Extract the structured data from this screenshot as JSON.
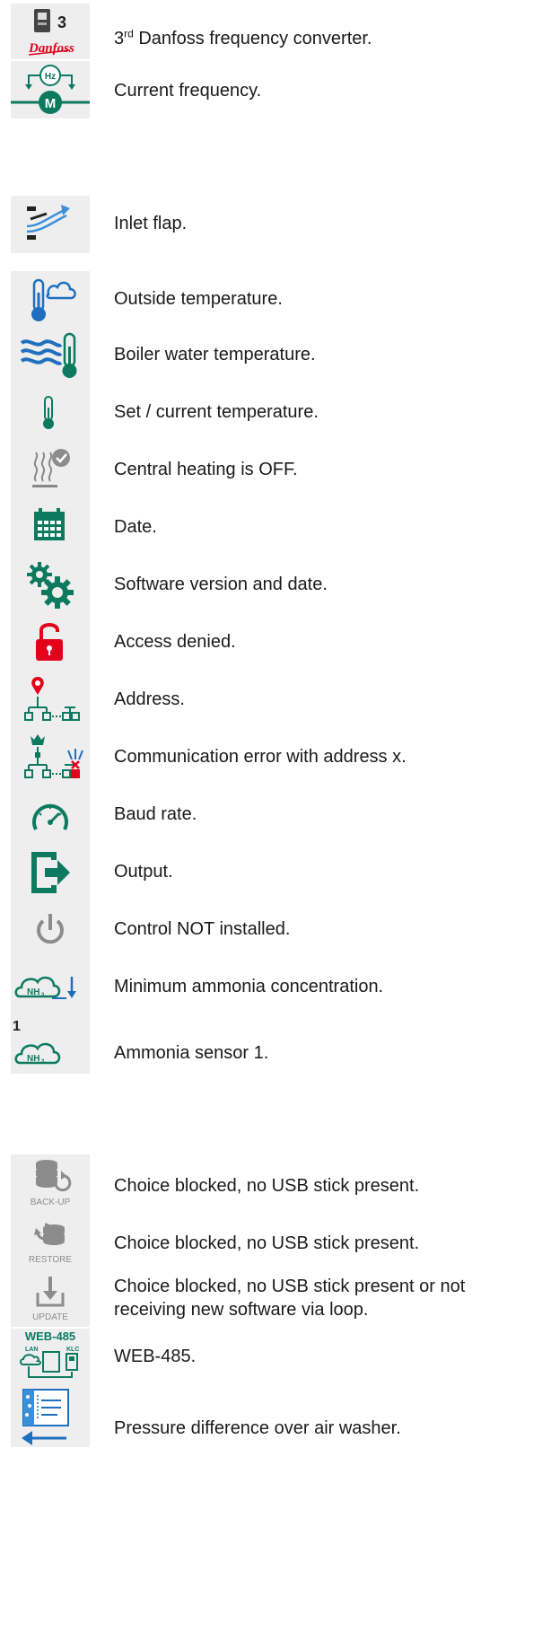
{
  "colors": {
    "green": "#0d7a5f",
    "red": "#e3001b",
    "blue": "#1f6fbf",
    "grey": "#8c8c8c",
    "icon_bg": "#eeeeee"
  },
  "rows": [
    {
      "icon": "danfoss-converter-icon",
      "icon_text_number": "3",
      "icon_text_brand": "Danfoss",
      "label_prefix": "3",
      "label_sup": "rd",
      "label": " Danfoss frequency converter."
    },
    {
      "icon": "frequency-motor-icon",
      "icon_text_hz": "Hz",
      "icon_text_m": "M",
      "label": "Current frequency."
    },
    {
      "icon": "inlet-flap-icon",
      "label": "Inlet flap."
    },
    {
      "icon": "outside-temperature-icon",
      "label": "Outside temperature."
    },
    {
      "icon": "boiler-water-temperature-icon",
      "label": "Boiler water temperature."
    },
    {
      "icon": "thermometer-icon",
      "label": "Set / current temperature."
    },
    {
      "icon": "central-heating-off-icon",
      "label": "Central heating is OFF."
    },
    {
      "icon": "calendar-icon",
      "label": "Date."
    },
    {
      "icon": "gears-icon",
      "label": "Software version and date."
    },
    {
      "icon": "unlocked-padlock-icon",
      "label": "Access denied."
    },
    {
      "icon": "address-network-icon",
      "label": "Address."
    },
    {
      "icon": "communication-error-icon",
      "label": "Communication error with address x."
    },
    {
      "icon": "speedometer-icon",
      "label": "Baud rate."
    },
    {
      "icon": "output-icon",
      "label": "Output."
    },
    {
      "icon": "power-icon",
      "label": "Control NOT installed."
    },
    {
      "icon": "ammonia-minimum-icon",
      "icon_text_nh3": "NH",
      "label": "Minimum ammonia concentration."
    },
    {
      "icon": "ammonia-sensor-icon",
      "icon_text_number": "1",
      "icon_text_nh3": "NH",
      "label": "Ammonia sensor 1."
    },
    {
      "icon": "backup-icon",
      "icon_text": "BACK-UP",
      "label": "Choice blocked, no USB stick present."
    },
    {
      "icon": "restore-icon",
      "icon_text": "RESTORE",
      "label": "Choice blocked, no USB stick present."
    },
    {
      "icon": "update-icon",
      "icon_text": "UPDATE",
      "label": "Choice blocked, no USB stick present or not receiving new software via loop."
    },
    {
      "icon": "web-485-icon",
      "icon_text": "WEB-485",
      "icon_text_lan": "LAN",
      "icon_text_klc": "KLC",
      "label": "WEB-485."
    },
    {
      "icon": "air-washer-pressure-icon",
      "label": "Pressure difference over air washer."
    }
  ]
}
